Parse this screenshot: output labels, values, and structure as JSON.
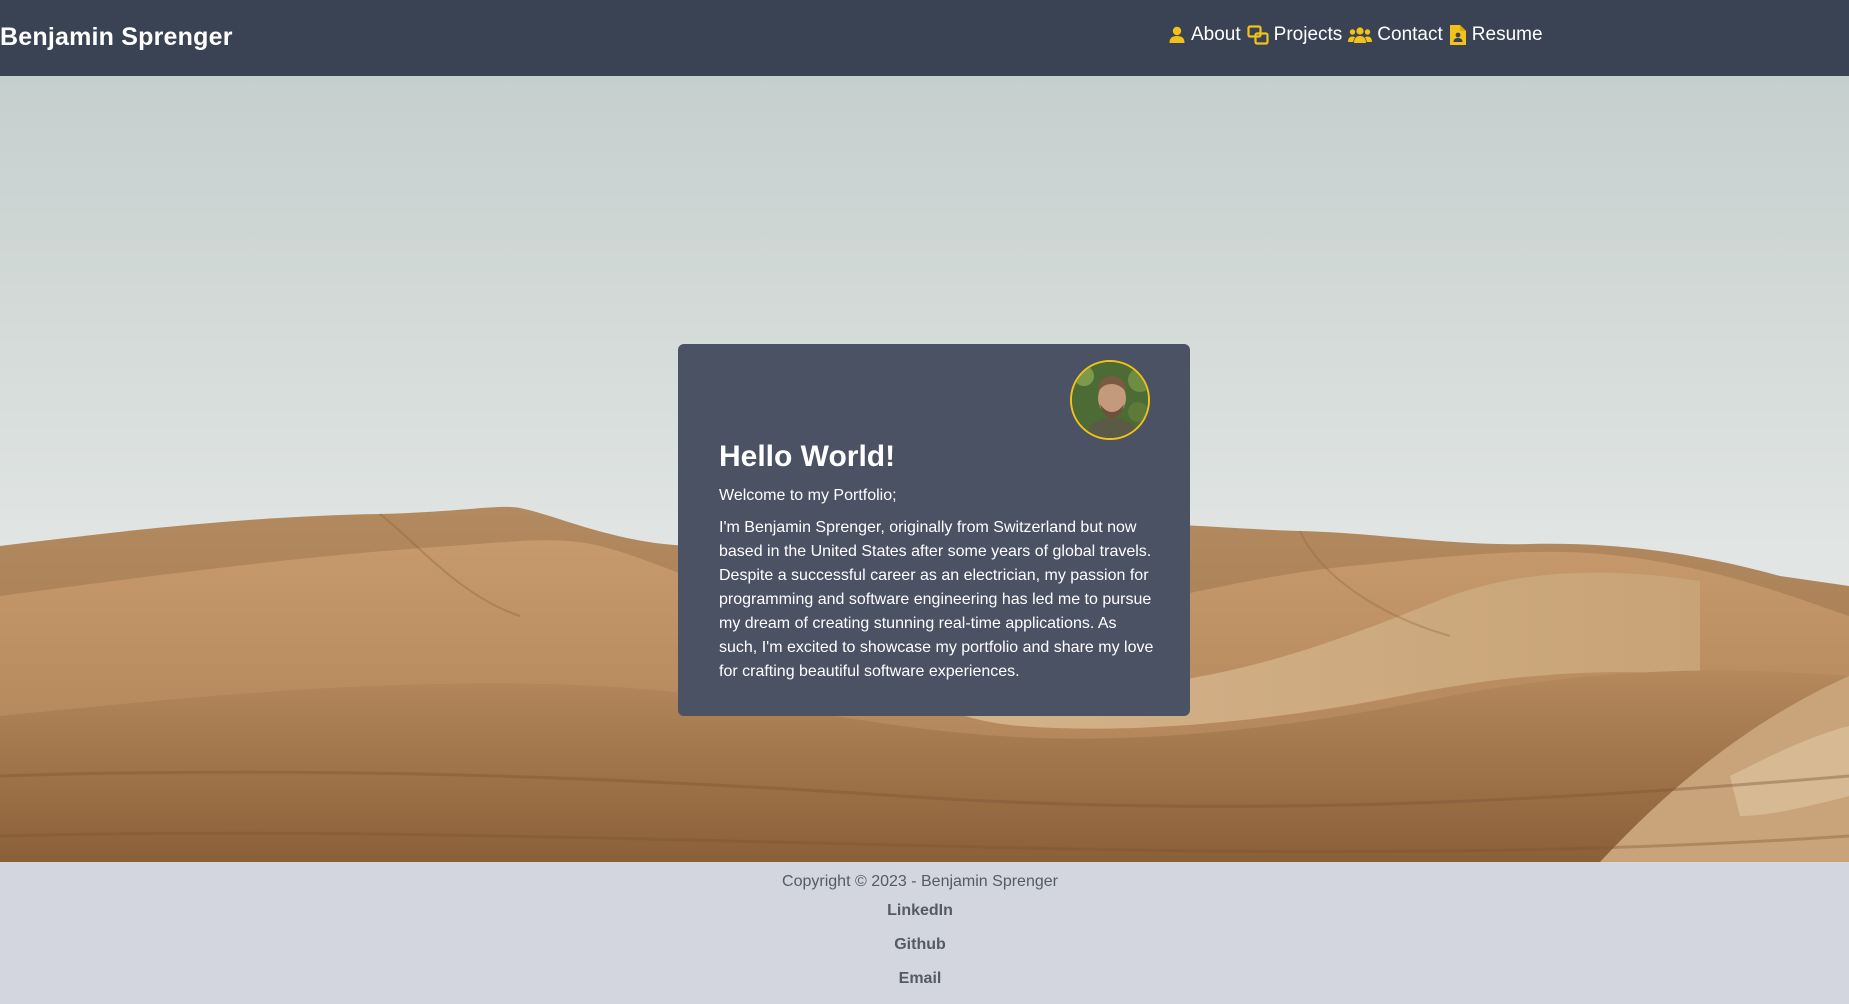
{
  "header": {
    "brand": "Benjamin Sprenger",
    "nav": [
      {
        "label": "About",
        "icon": "user-icon"
      },
      {
        "label": "Projects",
        "icon": "projects-icon"
      },
      {
        "label": "Contact",
        "icon": "users-icon"
      },
      {
        "label": "Resume",
        "icon": "file-user-icon"
      }
    ]
  },
  "card": {
    "title": "Hello World!",
    "subtitle": "Welcome to my Portfolio;",
    "bio": "I'm Benjamin Sprenger, originally from Switzerland but now based in the United States after some years of global travels. Despite a successful career as an electrician, my passion for programming and software engineering has led me to pursue my dream of creating stunning real-time applications. As such, I'm excited to showcase my portfolio and share my love for crafting beautiful software experiences."
  },
  "footer": {
    "copyright": "Copyright © 2023 - Benjamin Sprenger",
    "links": [
      "LinkedIn",
      "Github",
      "Email"
    ]
  },
  "colors": {
    "header_bg": "#3a4353",
    "card_bg": "#4a5263",
    "accent": "#f2c21b",
    "footer_bg": "#d3d6df"
  }
}
